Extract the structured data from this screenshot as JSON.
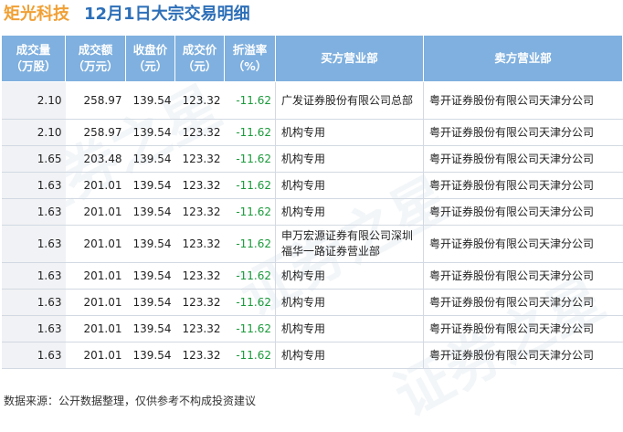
{
  "title": {
    "stock": "矩光科技",
    "text": "12月1日大宗交易明细"
  },
  "table": {
    "headers": {
      "volume": [
        "成交量",
        "（万股）"
      ],
      "amount": [
        "成交额",
        "（万元）"
      ],
      "close": [
        "收盘价",
        "（元）"
      ],
      "price": [
        "成交价",
        "（元）"
      ],
      "discount": [
        "折溢率",
        "（%）"
      ],
      "buyer": "买方营业部",
      "seller": "卖方营业部"
    },
    "rows": [
      {
        "volume": "2.10",
        "amount": "258.97",
        "close": "139.54",
        "price": "123.32",
        "discount": "-11.62",
        "buyer": "广发证券股份有限公司总部",
        "seller": "粤开证券股份有限公司天津分公司"
      },
      {
        "volume": "2.10",
        "amount": "258.97",
        "close": "139.54",
        "price": "123.32",
        "discount": "-11.62",
        "buyer": "机构专用",
        "seller": "粤开证券股份有限公司天津分公司"
      },
      {
        "volume": "1.65",
        "amount": "203.48",
        "close": "139.54",
        "price": "123.32",
        "discount": "-11.62",
        "buyer": "机构专用",
        "seller": "粤开证券股份有限公司天津分公司"
      },
      {
        "volume": "1.63",
        "amount": "201.01",
        "close": "139.54",
        "price": "123.32",
        "discount": "-11.62",
        "buyer": "机构专用",
        "seller": "粤开证券股份有限公司天津分公司"
      },
      {
        "volume": "1.63",
        "amount": "201.01",
        "close": "139.54",
        "price": "123.32",
        "discount": "-11.62",
        "buyer": "机构专用",
        "seller": "粤开证券股份有限公司天津分公司"
      },
      {
        "volume": "1.63",
        "amount": "201.01",
        "close": "139.54",
        "price": "123.32",
        "discount": "-11.62",
        "buyer": "申万宏源证券有限公司深圳福华一路证券营业部",
        "seller": "粤开证券股份有限公司天津分公司"
      },
      {
        "volume": "1.63",
        "amount": "201.01",
        "close": "139.54",
        "price": "123.32",
        "discount": "-11.62",
        "buyer": "机构专用",
        "seller": "粤开证券股份有限公司天津分公司"
      },
      {
        "volume": "1.63",
        "amount": "201.01",
        "close": "139.54",
        "price": "123.32",
        "discount": "-11.62",
        "buyer": "机构专用",
        "seller": "粤开证券股份有限公司天津分公司"
      },
      {
        "volume": "1.63",
        "amount": "201.01",
        "close": "139.54",
        "price": "123.32",
        "discount": "-11.62",
        "buyer": "机构专用",
        "seller": "粤开证券股份有限公司天津分公司"
      },
      {
        "volume": "1.63",
        "amount": "201.01",
        "close": "139.54",
        "price": "123.32",
        "discount": "-11.62",
        "buyer": "机构专用",
        "seller": "粤开证券股份有限公司天津分公司"
      }
    ]
  },
  "footer": "数据来源：公开数据整理，仅供参考不构成投资建议",
  "watermark": "证券之星",
  "colors": {
    "header_bg": "#7fb0df",
    "title_stock": "#f0a035",
    "title_text": "#2d6fb8",
    "negative": "#1a9a3a"
  }
}
